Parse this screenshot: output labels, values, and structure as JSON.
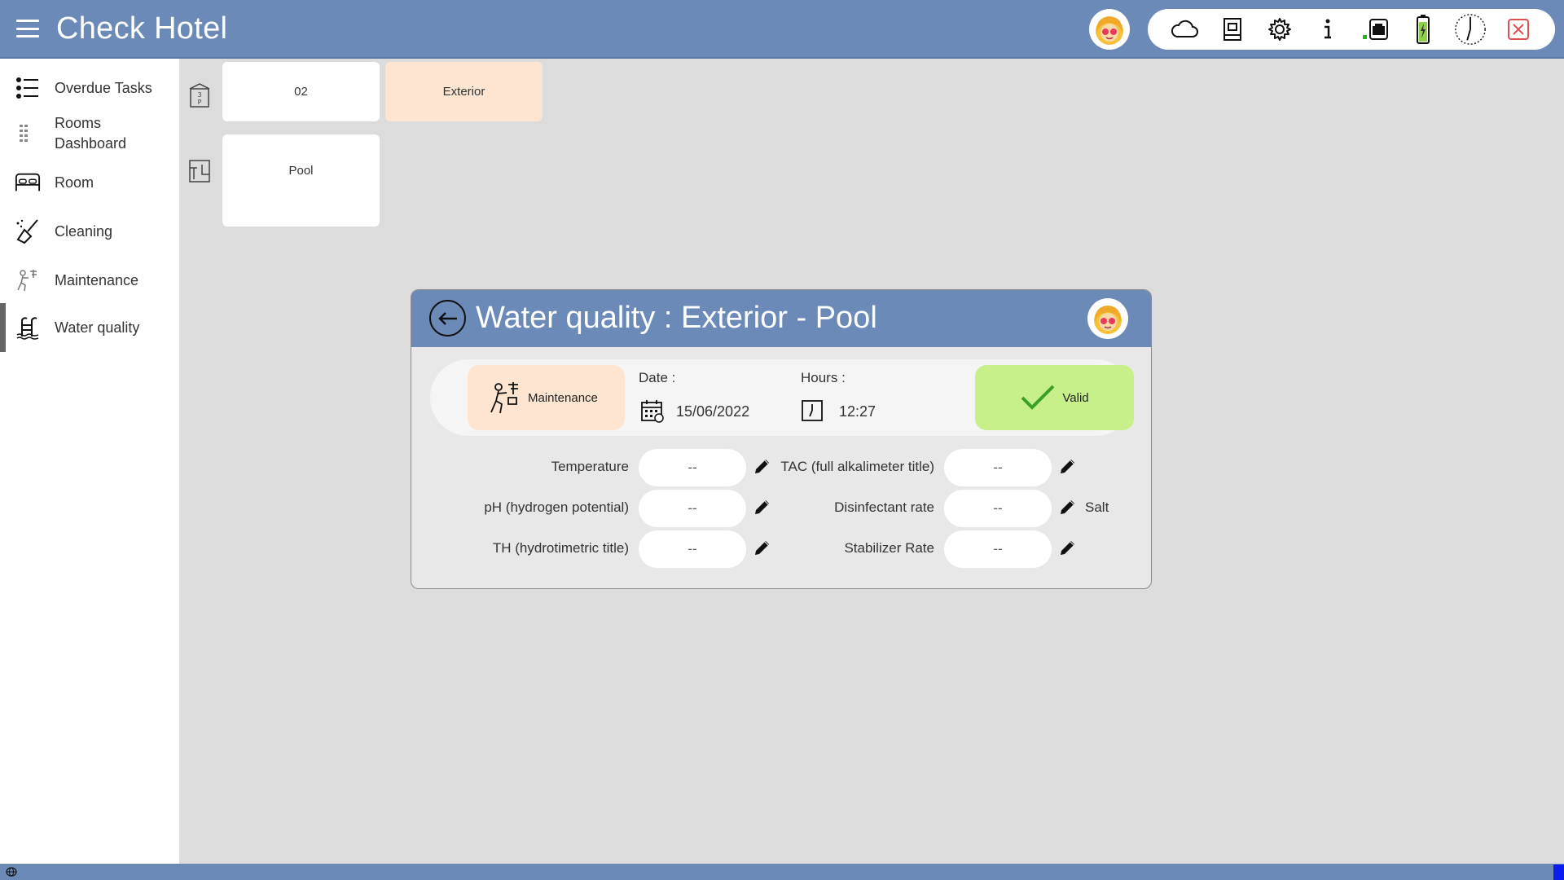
{
  "header": {
    "title": "Check Hotel",
    "toolbar_icons": [
      "cloud-icon",
      "document-icon",
      "gear-icon",
      "info-icon",
      "network-icon",
      "battery-icon",
      "clock-icon",
      "close-icon"
    ]
  },
  "sidebar": {
    "items": [
      {
        "label": "Overdue Tasks",
        "icon": "task-list-icon"
      },
      {
        "label": "Rooms Dashboard",
        "icon": "rooms-dashboard-icon"
      },
      {
        "label": "Room",
        "icon": "bed-icon"
      },
      {
        "label": "Cleaning",
        "icon": "broom-icon"
      },
      {
        "label": "Maintenance",
        "icon": "maintenance-icon"
      },
      {
        "label": "Water quality",
        "icon": "pool-ladder-icon"
      }
    ],
    "active": "Water quality"
  },
  "breadcrumb": {
    "row1": {
      "floor": "02",
      "zone": "Exterior"
    },
    "row2": {
      "place": "Pool"
    }
  },
  "dialog": {
    "title": "Water quality : Exterior - Pool",
    "maintenance_label": "Maintenance",
    "date_label": "Date :",
    "date_value": "15/06/2022",
    "hours_label": "Hours :",
    "hours_value": "12:27",
    "valid_label": "Valid",
    "fields_left": [
      {
        "label": "Temperature",
        "value": "--"
      },
      {
        "label": "pH (hydrogen potential)",
        "value": "--"
      },
      {
        "label": "TH (hydrotimetric title)",
        "value": "--"
      }
    ],
    "fields_right": [
      {
        "label": "TAC (full alkalimeter title)",
        "value": "--",
        "unit": ""
      },
      {
        "label": "Disinfectant rate",
        "value": "--",
        "unit": "Salt"
      },
      {
        "label": "Stabilizer Rate",
        "value": "--",
        "unit": ""
      }
    ]
  },
  "colors": {
    "header": "#6b8ab8",
    "peach": "#fde5d2",
    "valid_green": "#c8f08a",
    "background": "#dcdcdc"
  }
}
